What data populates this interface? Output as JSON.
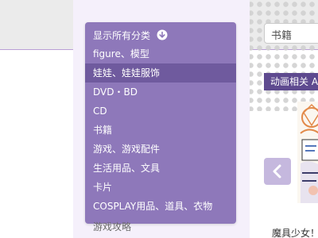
{
  "search": {
    "value": "书籍"
  },
  "category_menu": {
    "header_label": "显示所有分类",
    "items": [
      "figure、模型",
      "娃娃、娃娃服饰",
      "DVD・BD",
      "CD",
      "书籍",
      "游戏、游戏配件",
      "生活用品、文具",
      "卡片",
      "COSPLAY用品、道具、衣物"
    ],
    "active_item": "娃娃、娃娃服饰",
    "partial_item": "游戏攻略"
  },
  "anime_section": {
    "label": "动画相关 A"
  },
  "product": {
    "caption": "魔具少女！"
  },
  "colors": {
    "menu_bg": "#8e78ba",
    "menu_active": "#6f5a9e",
    "accent": "#5e4a8f",
    "arrow_button": "#c5b8de"
  },
  "icons": {
    "header_icon": "chevron-down-circle-icon",
    "prev_icon": "chevron-left-icon"
  }
}
